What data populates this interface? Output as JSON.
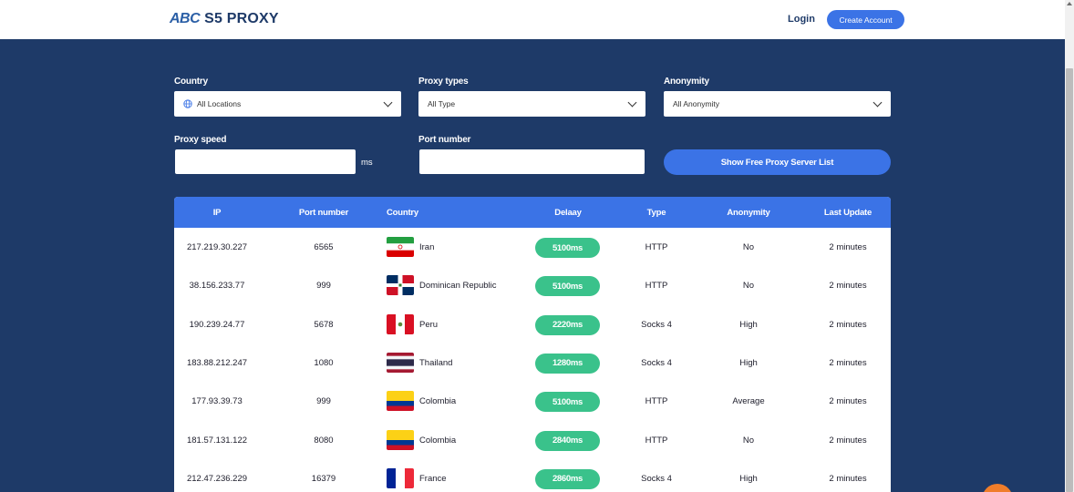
{
  "header": {
    "logo_abc": "ABC",
    "logo_rest": "S5 PROXY",
    "login": "Login",
    "create_account": "Create Account"
  },
  "filters": {
    "country": {
      "label": "Country",
      "value": "All Locations"
    },
    "proxy_types": {
      "label": "Proxy types",
      "value": "All Type"
    },
    "anonymity": {
      "label": "Anonymity",
      "value": "All Anonymity"
    },
    "proxy_speed": {
      "label": "Proxy speed",
      "unit": "ms"
    },
    "port_number": {
      "label": "Port number"
    },
    "show_button": "Show Free Proxy Server List"
  },
  "table": {
    "headers": [
      "IP",
      "Port number",
      "Country",
      "Delaay",
      "Type",
      "Anonymity",
      "Last Update"
    ],
    "rows": [
      {
        "ip": "217.219.30.227",
        "port": "6565",
        "country": "Iran",
        "flag": "iran",
        "delay": "5100ms",
        "type": "HTTP",
        "anonymity": "No",
        "update": "2 minutes"
      },
      {
        "ip": "38.156.233.77",
        "port": "999",
        "country": "Dominican Republic",
        "flag": "dominican",
        "delay": "5100ms",
        "type": "HTTP",
        "anonymity": "No",
        "update": "2 minutes"
      },
      {
        "ip": "190.239.24.77",
        "port": "5678",
        "country": "Peru",
        "flag": "peru",
        "delay": "2220ms",
        "type": "Socks 4",
        "anonymity": "High",
        "update": "2 minutes"
      },
      {
        "ip": "183.88.212.247",
        "port": "1080",
        "country": "Thailand",
        "flag": "thailand",
        "delay": "1280ms",
        "type": "Socks 4",
        "anonymity": "High",
        "update": "2 minutes"
      },
      {
        "ip": "177.93.39.73",
        "port": "999",
        "country": "Colombia",
        "flag": "colombia",
        "delay": "5100ms",
        "type": "HTTP",
        "anonymity": "Average",
        "update": "2 minutes"
      },
      {
        "ip": "181.57.131.122",
        "port": "8080",
        "country": "Colombia",
        "flag": "colombia",
        "delay": "2840ms",
        "type": "HTTP",
        "anonymity": "No",
        "update": "2 minutes"
      },
      {
        "ip": "212.47.236.229",
        "port": "16379",
        "country": "France",
        "flag": "france",
        "delay": "2860ms",
        "type": "Socks 4",
        "anonymity": "High",
        "update": "2 minutes"
      }
    ]
  },
  "colors": {
    "background": "#1e3a68",
    "accent": "#3b73e6",
    "delay_badge": "#3ac28b",
    "chat_widget": "#f07d2a"
  },
  "icons": [
    "globe-icon",
    "chevron-down-icon",
    "chat-icon"
  ]
}
